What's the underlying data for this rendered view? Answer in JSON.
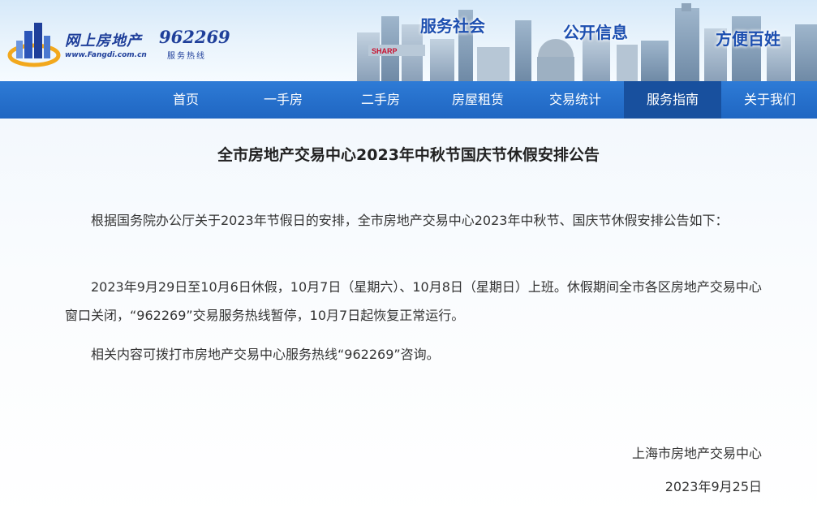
{
  "header": {
    "logo_text": "网上房地产",
    "logo_url": "www.Fangdi.com.cn",
    "hotline_number": "962269",
    "hotline_label": "服务热线",
    "slogans": [
      "服务社会",
      "公开信息",
      "方便百姓"
    ],
    "billboard_text": "SHARP"
  },
  "nav": {
    "items": [
      {
        "label": "首页"
      },
      {
        "label": "一手房"
      },
      {
        "label": "二手房"
      },
      {
        "label": "房屋租赁"
      },
      {
        "label": "交易统计"
      },
      {
        "label": "服务指南",
        "active": true
      },
      {
        "label": "关于我们"
      }
    ]
  },
  "article": {
    "title": "全市房地产交易中心2023年中秋节国庆节休假安排公告",
    "paragraphs": [
      "根据国务院办公厅关于2023年节假日的安排，全市房地产交易中心2023年中秋节、国庆节休假安排公告如下：",
      "2023年9月29日至10月6日休假，10月7日（星期六）、10月8日（星期日）上班。休假期间全市各区房地产交易中心窗口关闭，“962269”交易服务热线暂停，10月7日起恢复正常运行。",
      "相关内容可拨打市房地产交易中心服务热线“962269”咨询。"
    ],
    "signature_org": "上海市房地产交易中心",
    "signature_date": "2023年9月25日"
  },
  "colors": {
    "nav_bg": "#1f66c2",
    "nav_active": "#18509e",
    "brand_blue": "#1f3f9a"
  }
}
